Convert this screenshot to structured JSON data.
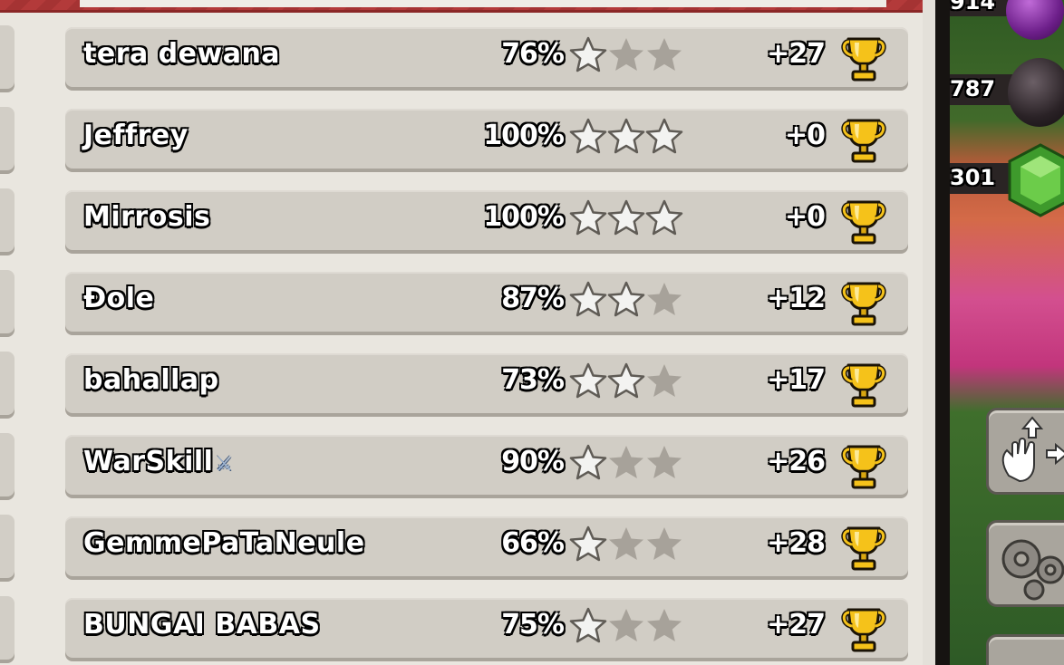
{
  "rows": [
    {
      "name": "tera dewana",
      "percent": "76%",
      "stars": 1,
      "trophy_delta": "+27"
    },
    {
      "name": "Jeffrey",
      "percent": "100%",
      "stars": 3,
      "trophy_delta": "+0"
    },
    {
      "name": "Mirrosis",
      "percent": "100%",
      "stars": 3,
      "trophy_delta": "+0"
    },
    {
      "name": "Ðole",
      "percent": "87%",
      "stars": 2,
      "trophy_delta": "+12"
    },
    {
      "name": "bahallap",
      "percent": "73%",
      "stars": 2,
      "trophy_delta": "+17"
    },
    {
      "name": "WarSkill",
      "name_suffix": "⚔",
      "percent": "90%",
      "stars": 1,
      "trophy_delta": "+26"
    },
    {
      "name": "GemmePaTaNeule",
      "percent": "66%",
      "stars": 1,
      "trophy_delta": "+28"
    },
    {
      "name": "BUNGAI BABAS",
      "percent": "75%",
      "stars": 1,
      "trophy_delta": "+27"
    }
  ],
  "resources": {
    "elixir": "914",
    "dark_elixir": "787",
    "gems": "301"
  },
  "icons": {
    "star": "star-icon",
    "trophy": "trophy-icon",
    "move": "move-icon",
    "settings": "settings-icon"
  },
  "colors": {
    "row_bg": "#d1cdc5",
    "panel_bg": "#e9e6df",
    "star_earned": "#f3f3f1",
    "star_empty": "#a7a29a",
    "trophy_gold": "#f5c21a",
    "banner_red": "#b33a3a"
  }
}
